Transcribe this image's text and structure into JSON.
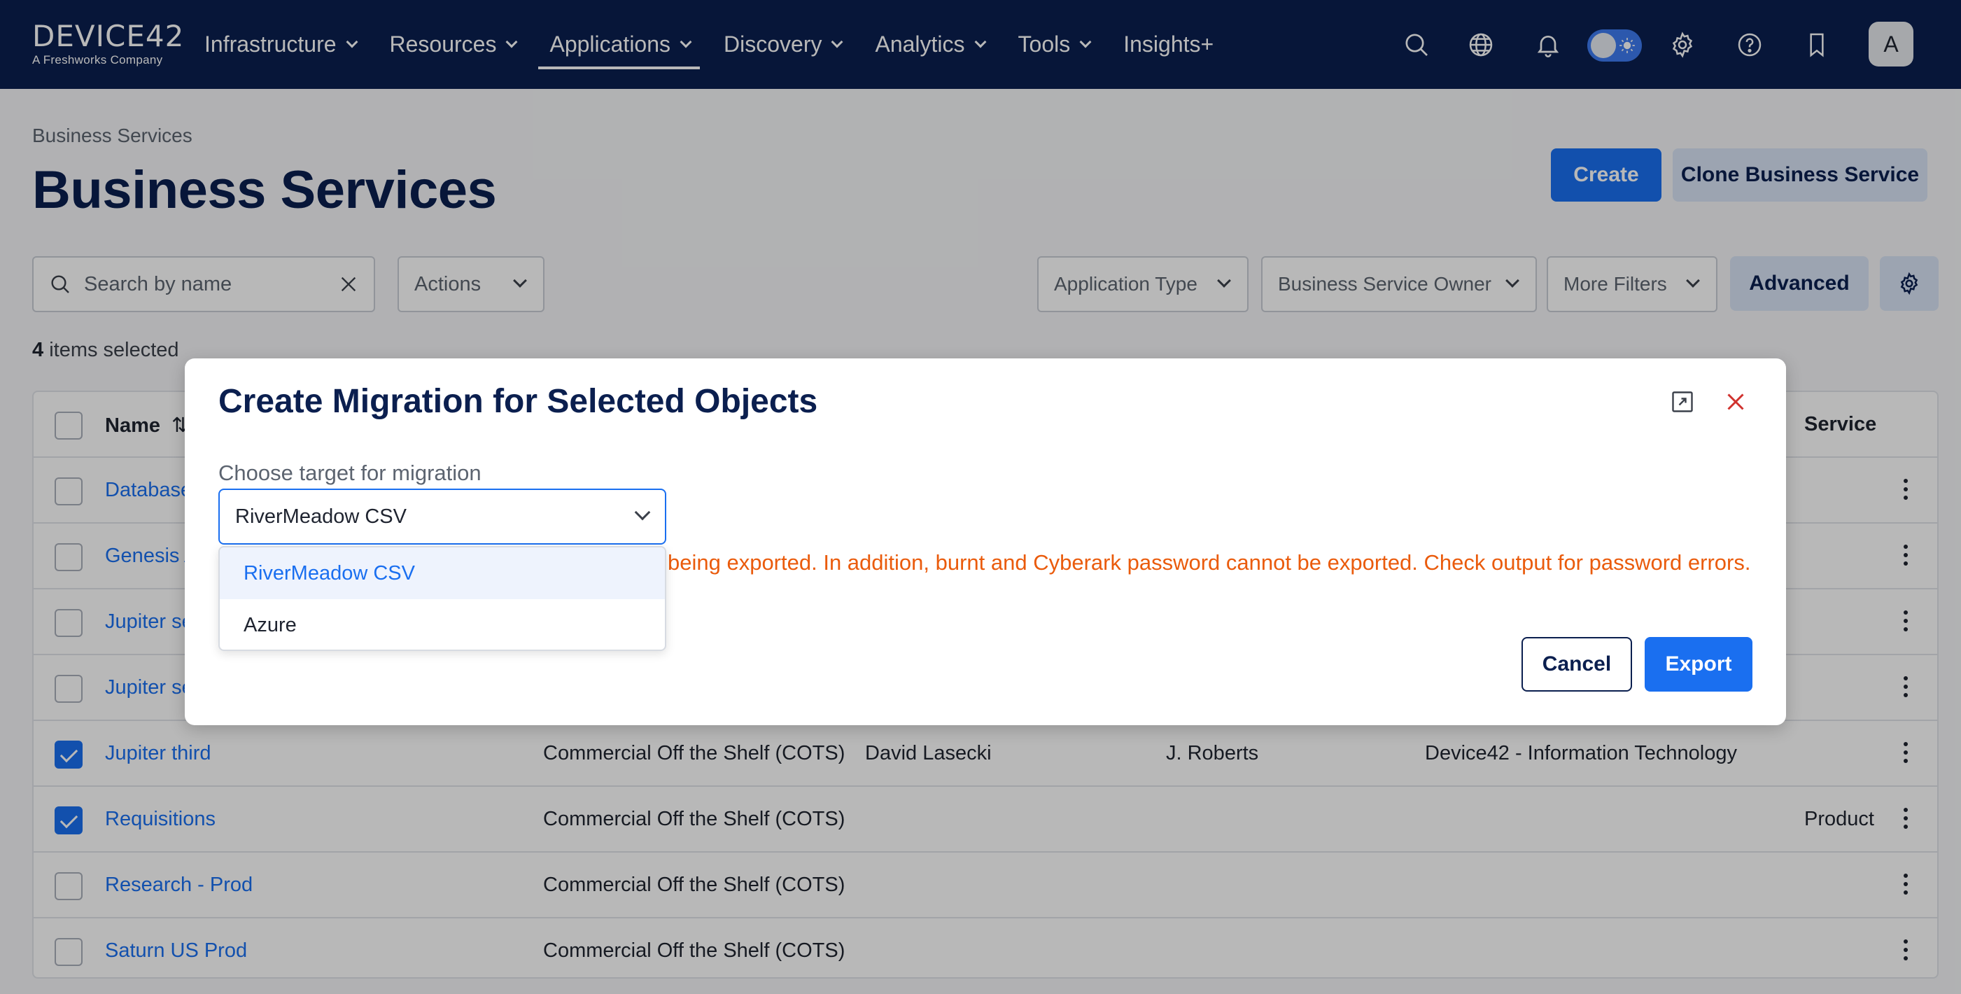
{
  "logo": {
    "mark": "DEVICE42",
    "sub": "A Freshworks Company"
  },
  "nav": {
    "items": [
      {
        "label": "Infrastructure"
      },
      {
        "label": "Resources"
      },
      {
        "label": "Applications"
      },
      {
        "label": "Discovery"
      },
      {
        "label": "Analytics"
      },
      {
        "label": "Tools"
      },
      {
        "label": "Insights+"
      }
    ],
    "active": "Applications",
    "avatar": "A"
  },
  "page": {
    "breadcrumb": "Business Services",
    "title": "Business Services",
    "create_label": "Create",
    "clone_label": "Clone Business Service",
    "search_placeholder": "Search by name",
    "actions_label": "Actions",
    "filters": {
      "application_type": "Application Type",
      "owner": "Business Service Owner",
      "more": "More Filters",
      "advanced": "Advanced"
    },
    "selected_count": "4",
    "selected_suffix": " items selected"
  },
  "table": {
    "headers": {
      "name": "Name",
      "service": "Service"
    },
    "rows": [
      {
        "name": "Database",
        "checked": false,
        "type": "",
        "owner": "",
        "contact": "",
        "dept": "",
        "service": ""
      },
      {
        "name": "Genesis A",
        "checked": false,
        "type": "",
        "owner": "",
        "contact": "",
        "dept": "",
        "service": ""
      },
      {
        "name": "Jupiter se",
        "checked": false,
        "type": "",
        "owner": "",
        "contact": "",
        "dept": "",
        "service": ""
      },
      {
        "name": "Jupiter se",
        "checked": false,
        "type": "",
        "owner": "",
        "contact": "",
        "dept": "",
        "service": ""
      },
      {
        "name": "Jupiter third",
        "checked": true,
        "type": "Commercial Off the Shelf (COTS)",
        "owner": "David Lasecki",
        "contact": "J. Roberts",
        "dept": "Device42 - Information Technology",
        "service": ""
      },
      {
        "name": "Requisitions",
        "checked": true,
        "type": "Commercial Off the Shelf (COTS)",
        "owner": "",
        "contact": "",
        "dept": "",
        "service": "Product"
      },
      {
        "name": "Research - Prod",
        "checked": false,
        "type": "Commercial Off the Shelf (COTS)",
        "owner": "",
        "contact": "",
        "dept": "",
        "service": ""
      },
      {
        "name": "Saturn US Prod",
        "checked": false,
        "type": "Commercial Off the Shelf (COTS)",
        "owner": "",
        "contact": "",
        "dept": "",
        "service": ""
      }
    ]
  },
  "modal": {
    "title": "Create Migration for Selected Objects",
    "label": "Choose target for migration",
    "selected": "RiverMeadow CSV",
    "options": [
      "RiverMeadow CSV",
      "Azure"
    ],
    "warning": "being exported. In addition, burnt and Cyberark password cannot be exported. Check output for password errors.",
    "cancel_label": "Cancel",
    "export_label": "Export"
  },
  "colors": {
    "nav_bg": "#0b1f4f",
    "primary": "#1a6ff0",
    "warning": "#ea5b0c"
  }
}
